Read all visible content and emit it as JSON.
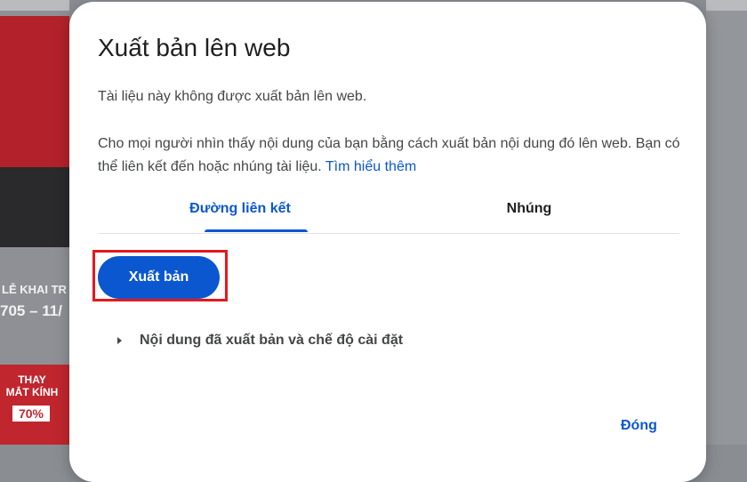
{
  "background": {
    "sign_line_1": "LỄ KHAI TR",
    "sign_line_2": "705 – 11/",
    "poster_title": "THAY MẮT KÍNH",
    "poster_discount": "70%"
  },
  "dialog": {
    "title": "Xuất bản lên web",
    "status": "Tài liệu này không được xuất bản lên web.",
    "description": "Cho mọi người nhìn thấy nội dung của bạn bằng cách xuất bản nội dung đó lên web. Bạn có thể liên kết đến hoặc nhúng tài liệu.",
    "learn_more": "Tìm hiểu thêm",
    "tabs": {
      "link": "Đường liên kết",
      "embed": "Nhúng"
    },
    "publish_button": "Xuất bản",
    "expander_label": "Nội dung đã xuất bản và chế độ cài đặt",
    "close_button": "Đóng"
  },
  "colors": {
    "accent": "#0b57d0",
    "highlight_border": "#e3191f"
  }
}
